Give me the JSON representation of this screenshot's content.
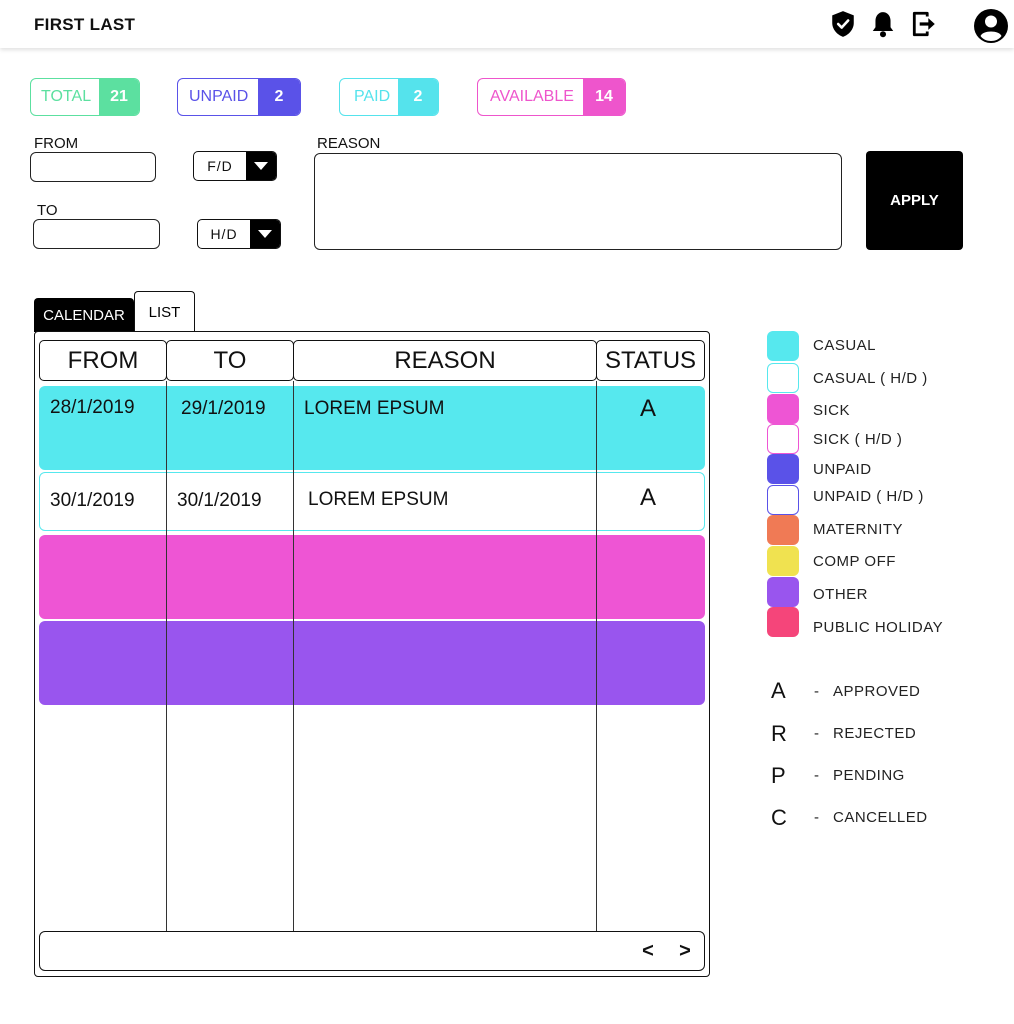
{
  "header": {
    "user_name": "FIRST LAST"
  },
  "icons": [
    "shield-icon",
    "bell-icon",
    "logout-icon",
    "user-account-icon"
  ],
  "stats": [
    {
      "label": "TOTAL",
      "count": "21",
      "color": "#5ce0a0"
    },
    {
      "label": "UNPAID",
      "count": "2",
      "color": "#5a52e8"
    },
    {
      "label": "PAID",
      "count": "2",
      "color": "#55e3ec"
    },
    {
      "label": "AVAILABLE",
      "count": "14",
      "color": "#ee55cc"
    }
  ],
  "form": {
    "from_label": "FROM",
    "to_label": "TO",
    "from_duration": "F/D",
    "to_duration": "H/D",
    "reason_label": "REASON",
    "apply_label": "APPLY"
  },
  "tabs": {
    "calendar": "CALENDAR",
    "list": "LIST"
  },
  "table": {
    "headers": [
      "FROM",
      "TO",
      "REASON",
      "STATUS"
    ],
    "rows": [
      {
        "from": "28/1/2019",
        "to": "29/1/2019",
        "reason": "LOREM EPSUM",
        "status": "A",
        "color": "#56e8ee"
      },
      {
        "from": "30/1/2019",
        "to": "30/1/2019",
        "reason": "LOREM EPSUM",
        "status": "A",
        "color": "#ffffff"
      },
      {
        "from": "",
        "to": "",
        "reason": "",
        "status": "",
        "color": "#ee55d4"
      },
      {
        "from": "",
        "to": "",
        "reason": "",
        "status": "",
        "color": "#9955ee"
      }
    ]
  },
  "pager": {
    "prev": "<",
    "next": ">"
  },
  "legend": [
    {
      "label": "CASUAL",
      "color": "#56e8ee"
    },
    {
      "label": "CASUAL ( H/D )",
      "color": "#ffffff",
      "border": "#56e8ee"
    },
    {
      "label": "SICK",
      "color": "#ee55d4"
    },
    {
      "label": "SICK ( H/D )",
      "color": "#ffffff",
      "border": "#ee55d4"
    },
    {
      "label": "UNPAID",
      "color": "#5a52e8"
    },
    {
      "label": "UNPAID ( H/D )",
      "color": "#ffffff",
      "border": "#5a52e8"
    },
    {
      "label": "MATERNITY",
      "color": "#f07a55"
    },
    {
      "label": "COMP OFF",
      "color": "#f0e250"
    },
    {
      "label": "OTHER",
      "color": "#9955ee"
    },
    {
      "label": "PUBLIC HOLIDAY",
      "color": "#f5457a"
    }
  ],
  "status_key": [
    {
      "letter": "A",
      "dash": "-",
      "label": "APPROVED"
    },
    {
      "letter": "R",
      "dash": "-",
      "label": "REJECTED"
    },
    {
      "letter": "P",
      "dash": "-",
      "label": "PENDING"
    },
    {
      "letter": "C",
      "dash": "-",
      "label": "CANCELLED"
    }
  ]
}
